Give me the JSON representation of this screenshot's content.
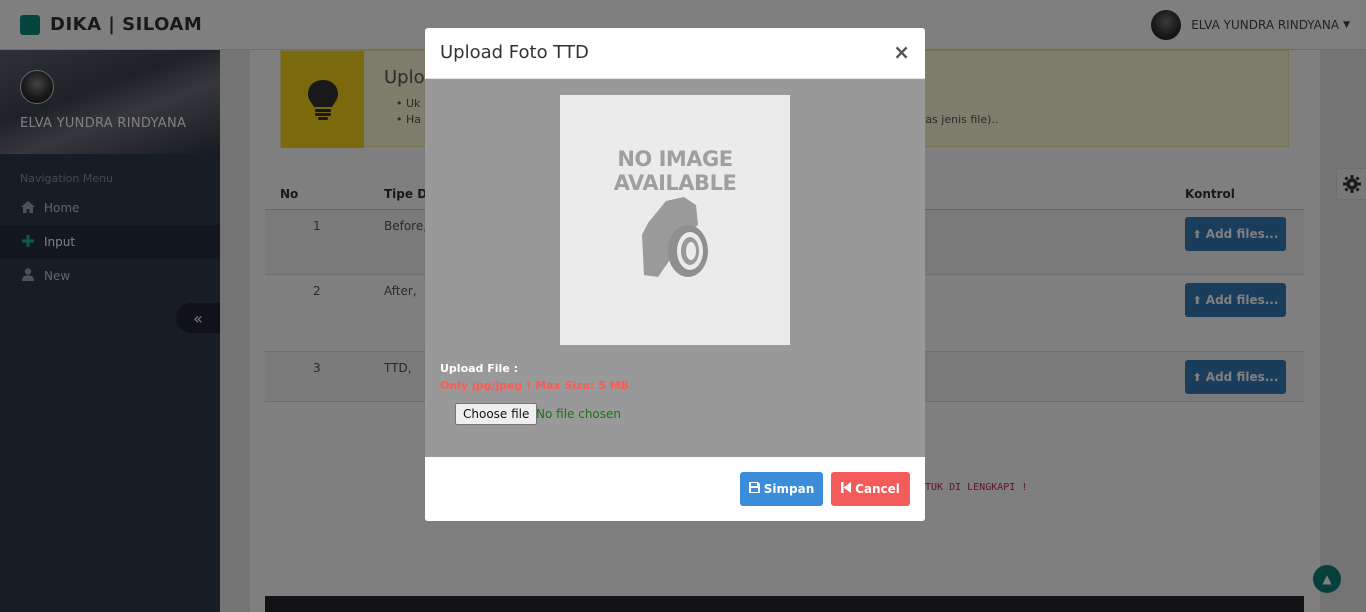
{
  "app": {
    "brand": "DIKA | SILOAM"
  },
  "user": {
    "name": "ELVA YUNDRA RINDYANA"
  },
  "sidebar": {
    "profile_name": "ELVA YUNDRA RINDYANA",
    "heading": "Navigation Menu",
    "items": [
      {
        "label": "Home",
        "icon": "home-icon"
      },
      {
        "label": "Input",
        "icon": "plus-icon"
      },
      {
        "label": "New",
        "icon": "user-icon"
      }
    ],
    "collapse_glyph": "«"
  },
  "callout": {
    "title": "Uplo",
    "items": [
      "Uk",
      "Ha"
    ],
    "tail": "tas jenis file).."
  },
  "table": {
    "headers": {
      "no": "No",
      "type": "Tipe Do",
      "control": "Kontrol"
    },
    "rows": [
      {
        "no": "1",
        "type": "Before,"
      },
      {
        "no": "2",
        "type": "After,"
      },
      {
        "no": "3",
        "type": "TTD,"
      }
    ],
    "add_label": "Add files..."
  },
  "warning": "TUK DI LENGKAPI !",
  "modal": {
    "title": "Upload Foto TTD",
    "close": "×",
    "placeholder_text": "NO IMAGE AVAILABLE",
    "upload_label": "Upload File :",
    "upload_note": "Only jpg/jpeg ! Max Size: 5 MB",
    "file_button": "Choose file",
    "file_status": "No file chosen",
    "save_label": "Simpan",
    "cancel_label": "Cancel"
  },
  "colors": {
    "accent": "#3c8dd9",
    "danger": "#f45b5b",
    "brand": "#0d8a7a",
    "warning_bg": "#f5d31b"
  }
}
